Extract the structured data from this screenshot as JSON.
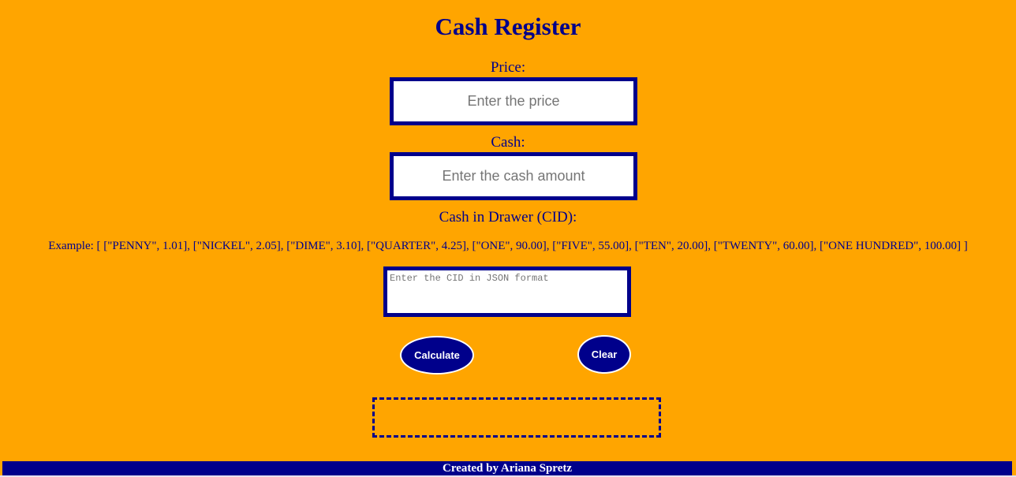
{
  "title": "Cash Register",
  "price": {
    "label": "Price:",
    "placeholder": "Enter the price",
    "value": ""
  },
  "cash": {
    "label": "Cash:",
    "placeholder": "Enter the cash amount",
    "value": ""
  },
  "cid": {
    "label": "Cash in Drawer (CID):",
    "example": "Example: [ [\"PENNY\", 1.01], [\"NICKEL\", 2.05], [\"DIME\", 3.10], [\"QUARTER\", 4.25], [\"ONE\", 90.00], [\"FIVE\", 55.00], [\"TEN\", 20.00], [\"TWENTY\", 60.00], [\"ONE HUNDRED\", 100.00] ]",
    "placeholder": "Enter the CID in JSON format"
  },
  "buttons": {
    "calculate": "Calculate",
    "clear": "Clear"
  },
  "output": "",
  "footer": "Created by Ariana Spretz",
  "colors": {
    "background": "#FFA500",
    "accent": "#00008B"
  }
}
